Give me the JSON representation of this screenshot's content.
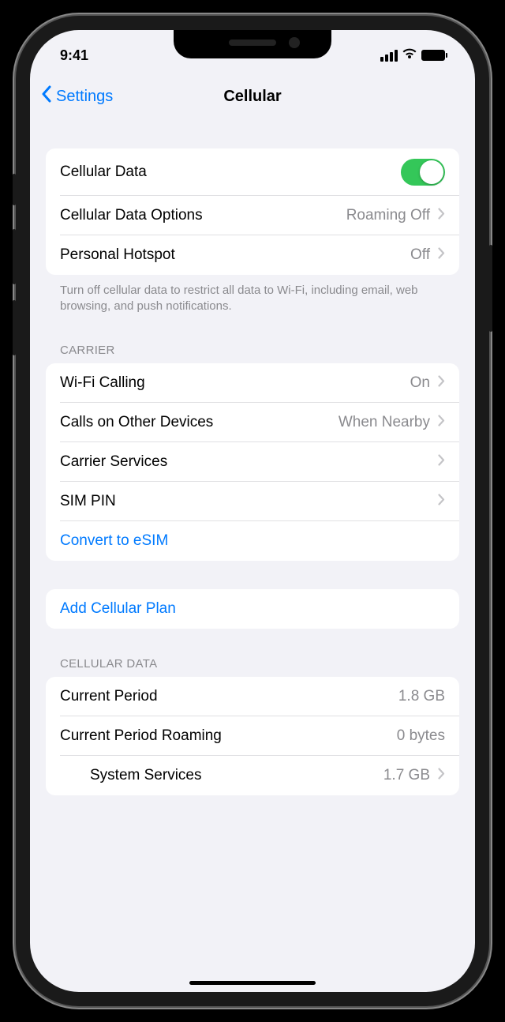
{
  "status": {
    "time": "9:41"
  },
  "nav": {
    "back_label": "Settings",
    "title": "Cellular"
  },
  "section1": {
    "cellular_data_label": "Cellular Data",
    "cellular_data_on": true,
    "options_label": "Cellular Data Options",
    "options_value": "Roaming Off",
    "hotspot_label": "Personal Hotspot",
    "hotspot_value": "Off",
    "footer": "Turn off cellular data to restrict all data to Wi-Fi, including email, web browsing, and push notifications."
  },
  "carrier": {
    "header": "CARRIER",
    "wifi_calling_label": "Wi-Fi Calling",
    "wifi_calling_value": "On",
    "other_devices_label": "Calls on Other Devices",
    "other_devices_value": "When Nearby",
    "services_label": "Carrier Services",
    "sim_pin_label": "SIM PIN",
    "convert_label": "Convert to eSIM"
  },
  "add_plan": {
    "label": "Add Cellular Plan"
  },
  "data_usage": {
    "header": "CELLULAR DATA",
    "current_label": "Current Period",
    "current_value": "1.8 GB",
    "roaming_label": "Current Period Roaming",
    "roaming_value": "0 bytes",
    "system_label": "System Services",
    "system_value": "1.7 GB"
  }
}
